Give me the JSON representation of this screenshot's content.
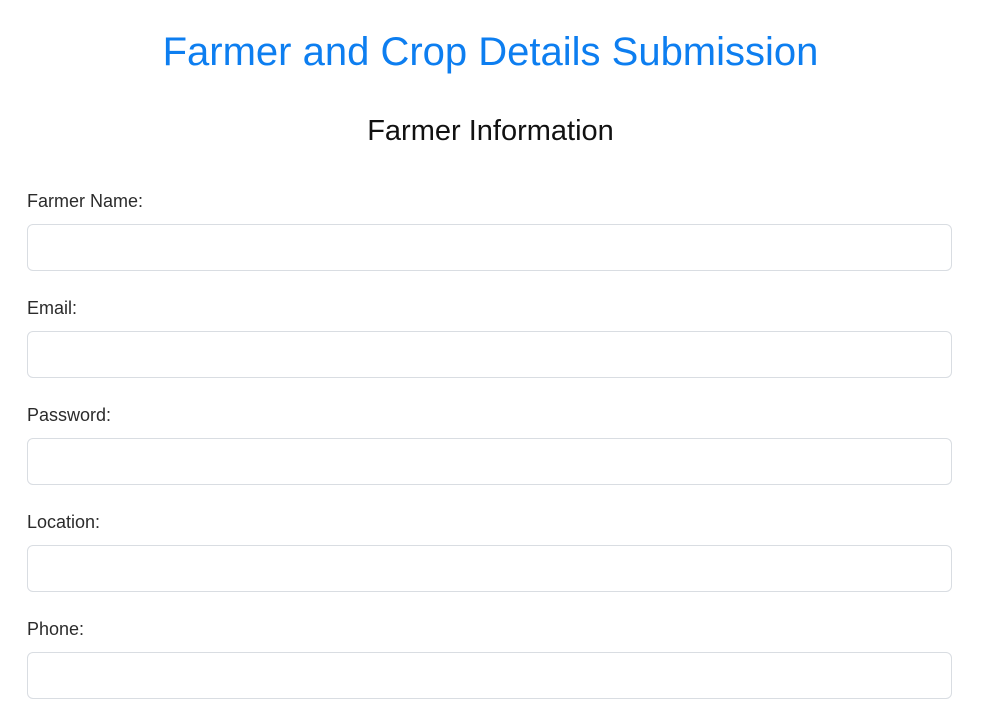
{
  "page": {
    "title": "Farmer and Crop Details Submission",
    "section_title": "Farmer Information"
  },
  "form": {
    "fields": [
      {
        "label": "Farmer Name:",
        "value": "",
        "placeholder": ""
      },
      {
        "label": "Email:",
        "value": "",
        "placeholder": ""
      },
      {
        "label": "Password:",
        "value": "",
        "placeholder": ""
      },
      {
        "label": "Location:",
        "value": "",
        "placeholder": ""
      },
      {
        "label": "Phone:",
        "value": "",
        "placeholder": ""
      }
    ]
  },
  "colors": {
    "title": "#0d7ef0",
    "section_title": "#111111",
    "label": "#2b2b2b",
    "input_border": "#d9dde2"
  }
}
